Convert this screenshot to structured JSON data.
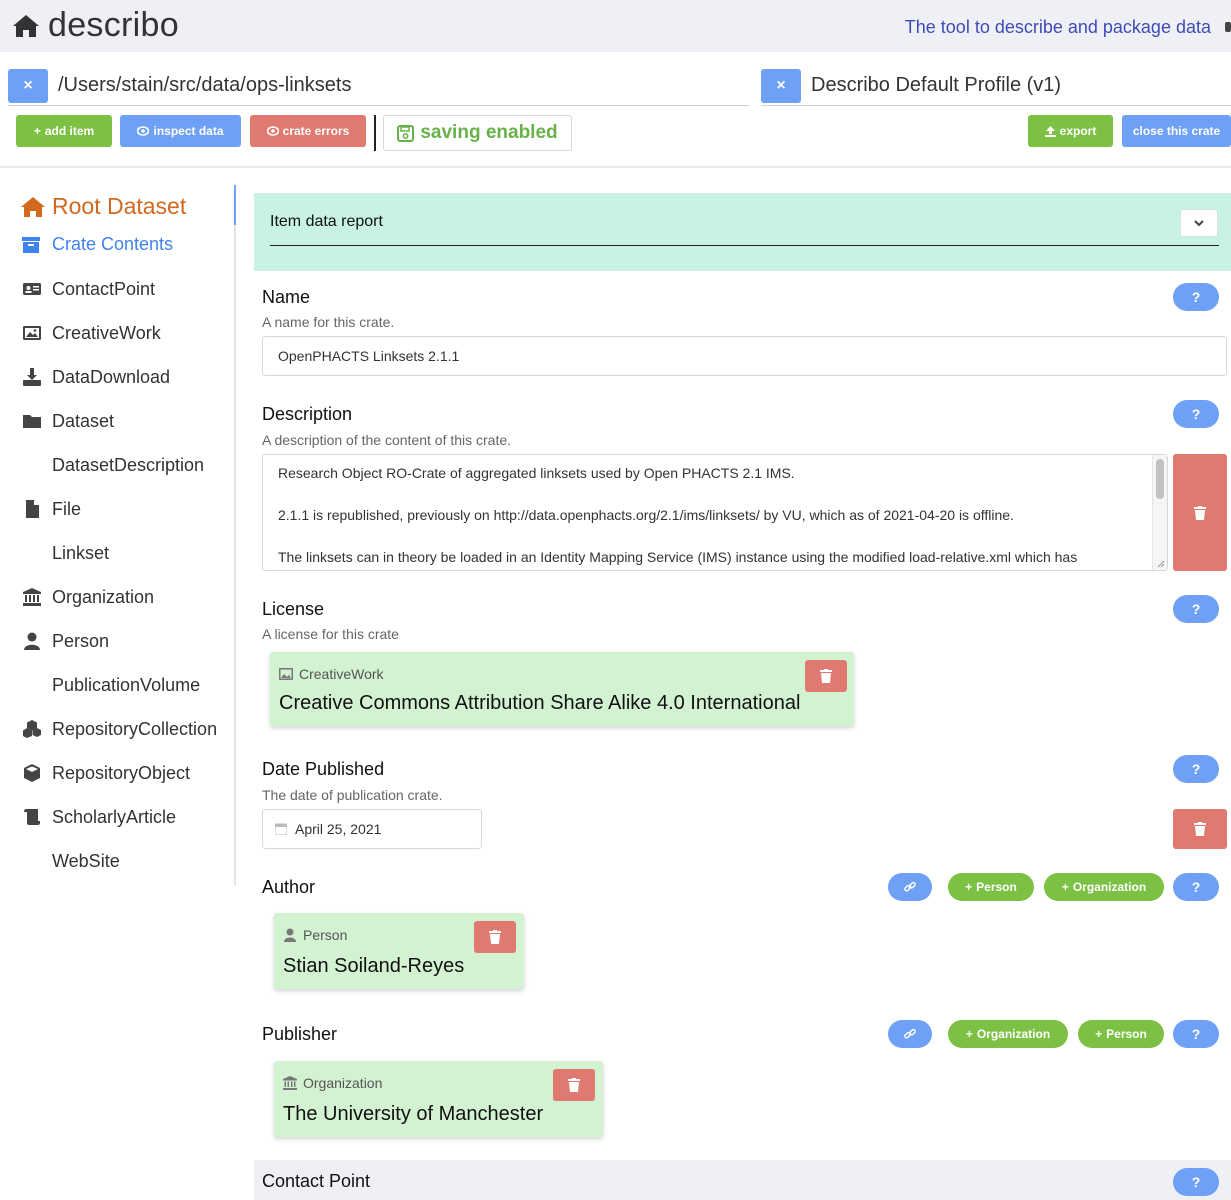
{
  "header": {
    "brand": "describo",
    "tagline": "The tool to describe and package data"
  },
  "paths": {
    "crate_path": "/Users/stain/src/data/ops-linksets",
    "profile": "Describo Default Profile (v1)",
    "close_symbol": "×"
  },
  "toolbar": {
    "add_item": "add item",
    "inspect_data": "inspect data",
    "crate_errors": "crate errors",
    "saving": "saving enabled",
    "export": "export",
    "close_crate": "close this crate"
  },
  "sidebar": {
    "root": "Root Dataset",
    "crate_contents": "Crate Contents",
    "items": [
      {
        "label": "ContactPoint",
        "icon": "id-card-icon"
      },
      {
        "label": "CreativeWork",
        "icon": "image-icon"
      },
      {
        "label": "DataDownload",
        "icon": "download-icon"
      },
      {
        "label": "Dataset",
        "icon": "folder-icon"
      },
      {
        "label": "DatasetDescription",
        "icon": ""
      },
      {
        "label": "File",
        "icon": "file-icon"
      },
      {
        "label": "Linkset",
        "icon": ""
      },
      {
        "label": "Organization",
        "icon": "bank-icon"
      },
      {
        "label": "Person",
        "icon": "user-icon"
      },
      {
        "label": "PublicationVolume",
        "icon": ""
      },
      {
        "label": "RepositoryCollection",
        "icon": "cubes-icon"
      },
      {
        "label": "RepositoryObject",
        "icon": "cube-icon"
      },
      {
        "label": "ScholarlyArticle",
        "icon": "scroll-icon"
      },
      {
        "label": "WebSite",
        "icon": ""
      }
    ]
  },
  "report": {
    "title": "Item data report"
  },
  "fields": {
    "help": "?",
    "name": {
      "title": "Name",
      "help": "A name for this crate.",
      "value": "OpenPHACTS Linksets 2.1.1"
    },
    "description": {
      "title": "Description",
      "help": "A description of the content of this crate.",
      "lines": [
        "Research Object RO-Crate of aggregated linksets used by Open PHACTS 2.1 IMS.",
        "2.1.1 is republished, previously on http://data.openphacts.org/2.1/ims/linksets/ by VU, which as of 2021-04-20 is offline.",
        "The linksets can in theory be loaded in an Identity Mapping Service (IMS) instance using the modified load-relative.xml which has"
      ]
    },
    "license": {
      "title": "License",
      "help": "A license for this crate",
      "card_type": "CreativeWork",
      "card_name": "Creative Commons Attribution Share Alike 4.0 International"
    },
    "date_published": {
      "title": "Date Published",
      "help": "The date of publication crate.",
      "value": "April 25, 2021"
    },
    "author": {
      "title": "Author",
      "add_person": "Person",
      "add_org": "Organization",
      "card_type": "Person",
      "card_name": "Stian Soiland-Reyes"
    },
    "publisher": {
      "title": "Publisher",
      "add_org": "Organization",
      "add_person": "Person",
      "card_type": "Organization",
      "card_name": "The University of Manchester"
    },
    "contact_point": {
      "title": "Contact Point"
    }
  },
  "colors": {
    "accent_blue": "#6ea1f5",
    "green": "#7cc144",
    "red": "#e07a70",
    "card_green": "#d3f2d1",
    "report_teal": "#c7f2e4",
    "root_orange": "#d2691e"
  }
}
